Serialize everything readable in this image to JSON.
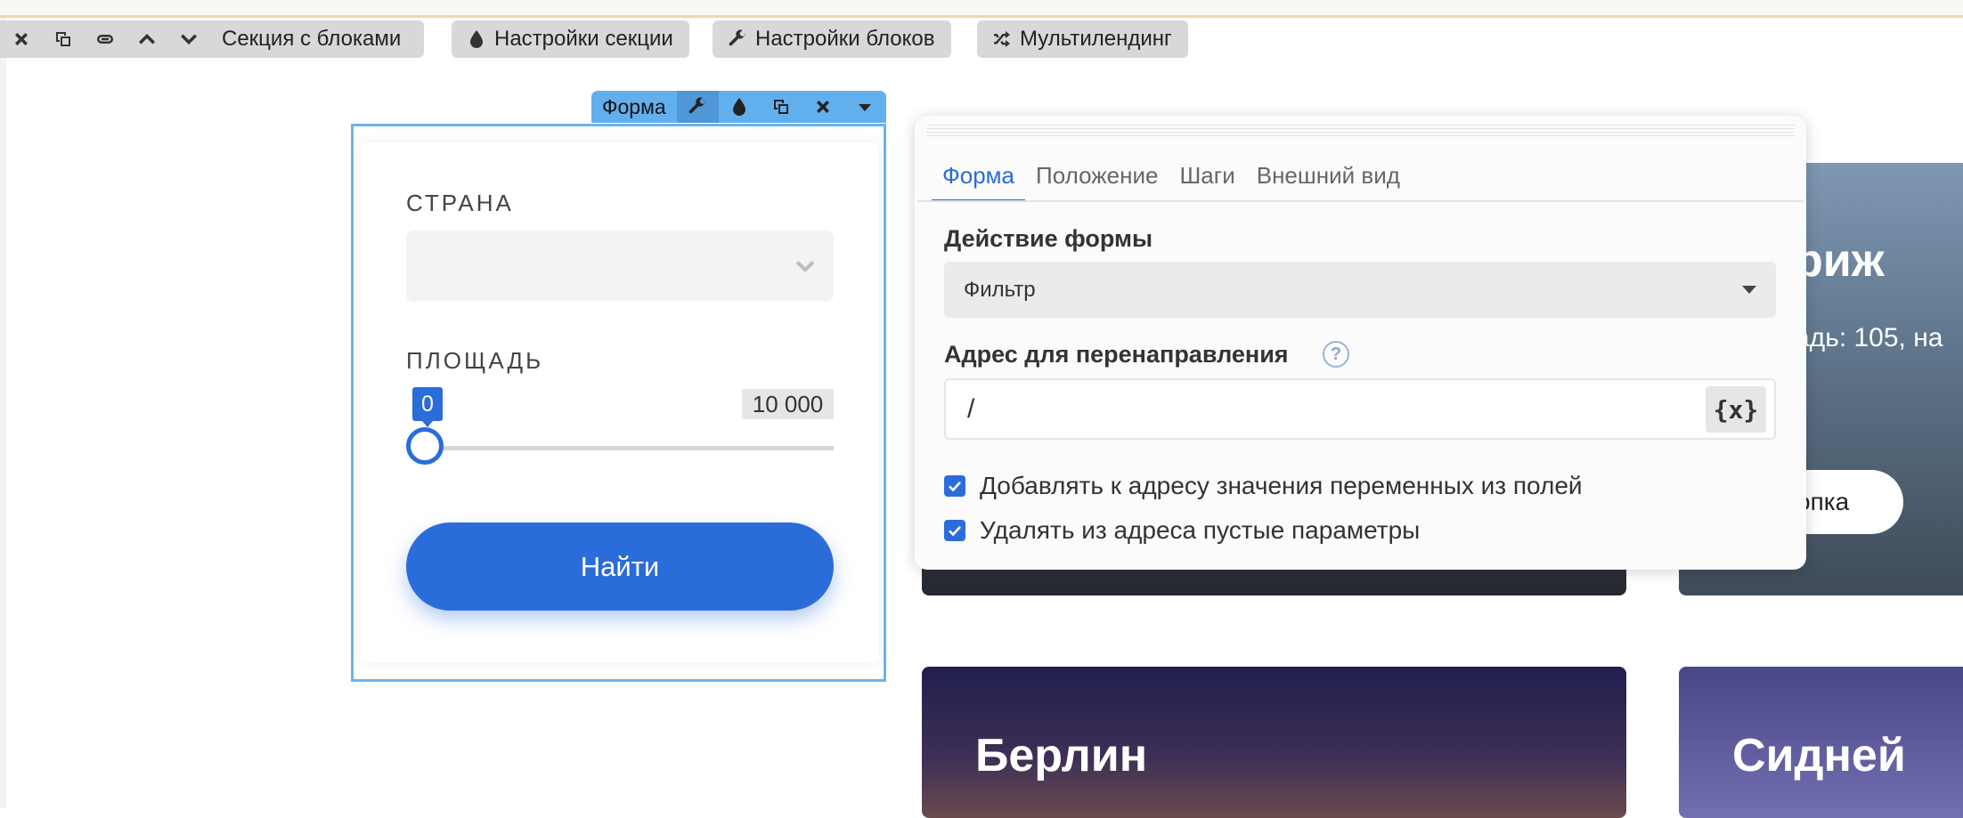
{
  "section_toolbar": {
    "label": "Секция с блоками",
    "icons": [
      "close-icon",
      "duplicate-icon",
      "link-icon",
      "chevron-up-icon",
      "chevron-down-icon"
    ],
    "buttons": {
      "section_settings": "Настройки секции",
      "block_settings": "Настройки блоков",
      "multilanding": "Мультилендинг"
    }
  },
  "form_block": {
    "tag_label": "Форма",
    "country_label": "СТРАНА",
    "country_value": "",
    "area_label": "ПЛОЩАДЬ",
    "slider": {
      "min_label": "0",
      "max_label": "10 000",
      "value": 0
    },
    "submit_label": "Найти"
  },
  "cards": {
    "paris_title": "риж",
    "paris_sub": "адь: 105, на",
    "paris_button": "опка",
    "berlin_title": "Берлин",
    "sydney_title": "Сидней"
  },
  "panel": {
    "tabs": [
      "Форма",
      "Положение",
      "Шаги",
      "Внешний вид"
    ],
    "active_tab": "Форма",
    "action_label": "Действие формы",
    "action_value": "Фильтр",
    "redirect_label": "Адрес для перенаправления",
    "help_glyph": "?",
    "redirect_value": "/",
    "variables_button": "{x}",
    "checkbox1": {
      "label": "Добавлять к адресу значения переменных из полей",
      "checked": true
    },
    "checkbox2": {
      "label": "Удалять из адреса пустые параметры",
      "checked": true
    }
  },
  "colors": {
    "accent": "#2b6cdb",
    "form_frame": "#6ab3ee",
    "toolbar_bg": "#d8d8d8"
  }
}
